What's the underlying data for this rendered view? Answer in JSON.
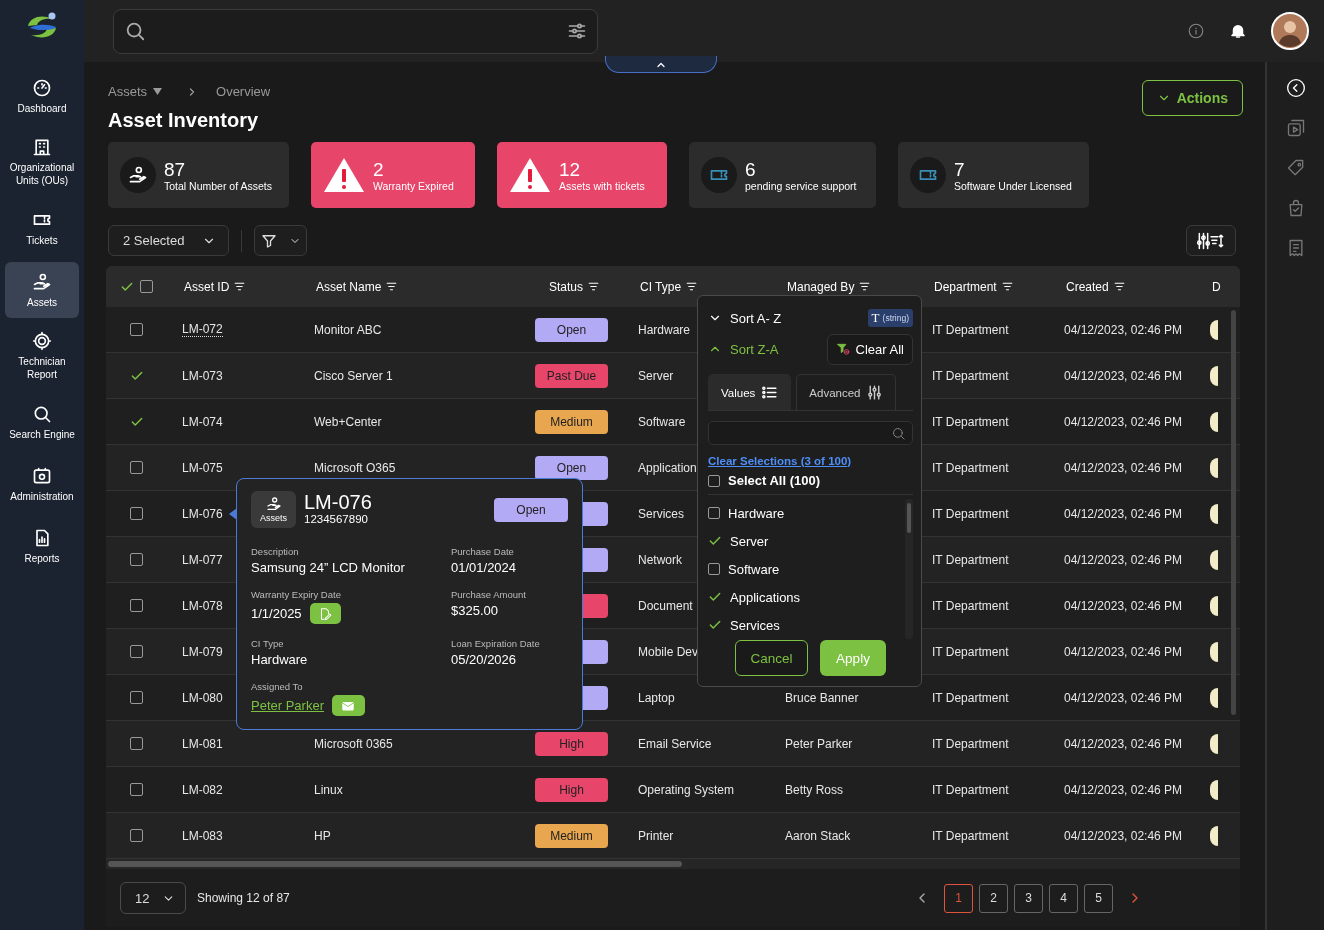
{
  "sidebar": {
    "items": [
      {
        "label": "Dashboard",
        "selected": false
      },
      {
        "label": "Organizational Units (OUs)",
        "selected": false
      },
      {
        "label": "Tickets",
        "selected": false
      },
      {
        "label": "Assets",
        "selected": true
      },
      {
        "label": "Technician Report",
        "selected": false
      },
      {
        "label": "Search Engine",
        "selected": false
      },
      {
        "label": "Administration",
        "selected": false
      },
      {
        "label": "Reports",
        "selected": false
      }
    ]
  },
  "breadcrumb": [
    "Assets",
    "Overview"
  ],
  "page_title": "Asset Inventory",
  "actions_button": "Actions",
  "stat_cards": [
    {
      "value": "87",
      "label": "Total Number of Assets",
      "kind": "total"
    },
    {
      "value": "2",
      "label": "Warranty Expired",
      "kind": "alert"
    },
    {
      "value": "12",
      "label": "Assets with tickets",
      "kind": "alert"
    },
    {
      "value": "6",
      "label": "pending service support",
      "kind": "ticket"
    },
    {
      "value": "7",
      "label": "Software Under Licensed",
      "kind": "ticket"
    }
  ],
  "toolbar": {
    "selection": "2 Selected"
  },
  "table": {
    "header_checked": false,
    "columns": [
      "Asset ID",
      "Asset Name",
      "Status",
      "CI Type",
      "Managed By",
      "Department",
      "Created",
      "D"
    ],
    "rows": [
      {
        "checked": false,
        "linked": true,
        "expanded": false,
        "asset_id": "LM-072",
        "asset_name": "Monitor ABC",
        "status": "Open",
        "color": "#b3aaf5",
        "ci_type": "Hardware",
        "department": "IT Department",
        "created": "04/12/2023, 02:46 PM"
      },
      {
        "checked": true,
        "linked": false,
        "expanded": false,
        "asset_id": "LM-073",
        "asset_name": "Cisco Server 1",
        "status": "Past Due",
        "color": "#e8456b",
        "ci_type": "Server",
        "department": "IT Department",
        "created": "04/12/2023, 02:46 PM"
      },
      {
        "checked": true,
        "linked": false,
        "expanded": false,
        "asset_id": "LM-074",
        "asset_name": "Web+Center",
        "status": "Medium",
        "color": "#e8a64f",
        "ci_type": "Software",
        "department": "IT Department",
        "created": "04/12/2023, 02:46 PM"
      },
      {
        "checked": false,
        "linked": false,
        "expanded": false,
        "asset_id": "LM-075",
        "asset_name": "Microsoft O365",
        "status": "Open",
        "color": "#b3aaf5",
        "ci_type": "Application",
        "department": "IT Department",
        "created": "04/12/2023, 02:46 PM"
      },
      {
        "checked": false,
        "linked": false,
        "expanded": true,
        "asset_id": "LM-076",
        "color": "#b3aaf5",
        "ci_type": "Services",
        "department": "IT Department",
        "created": "04/12/2023, 02:46 PM"
      },
      {
        "checked": false,
        "linked": false,
        "expanded": false,
        "asset_id": "LM-077",
        "color": "#b3aaf5",
        "ci_type": "Network",
        "department": "IT Department",
        "created": "04/12/2023, 02:46 PM"
      },
      {
        "checked": false,
        "linked": false,
        "expanded": false,
        "asset_id": "LM-078",
        "color": "#e8456b",
        "ci_type": "Document",
        "department": "IT Department",
        "created": "04/12/2023, 02:46 PM"
      },
      {
        "checked": false,
        "linked": false,
        "expanded": false,
        "asset_id": "LM-079",
        "color": "#b3aaf5",
        "ci_type": "Mobile Dev",
        "department": "IT Department",
        "created": "04/12/2023, 02:46 PM"
      },
      {
        "checked": false,
        "linked": false,
        "expanded": false,
        "asset_id": "LM-080",
        "color": "#b3aaf5",
        "ci_type": "Laptop",
        "managed_by": "Bruce Banner",
        "department": "IT Department",
        "created": "04/12/2023, 02:46 PM"
      },
      {
        "checked": false,
        "linked": false,
        "expanded": false,
        "asset_id": "LM-081",
        "asset_name": "Microsoft 0365",
        "status": "High",
        "color": "#e8456b",
        "ci_type": "Email Service",
        "managed_by": "Peter Parker",
        "department": "IT Department",
        "created": "04/12/2023, 02:46 PM"
      },
      {
        "checked": false,
        "linked": false,
        "expanded": false,
        "asset_id": "LM-082",
        "asset_name": "Linux",
        "status": "High",
        "color": "#e8456b",
        "ci_type": "Operating System",
        "managed_by": "Betty Ross",
        "department": "IT Department",
        "created": "04/12/2023, 02:46 PM"
      },
      {
        "checked": false,
        "linked": false,
        "expanded": false,
        "asset_id": "LM-083",
        "asset_name": "HP",
        "status": "Medium",
        "color": "#e8a64f",
        "ci_type": "Printer",
        "managed_by": "Aaron Stack",
        "department": "IT Department",
        "created": "04/12/2023, 02:46 PM"
      }
    ]
  },
  "asset_popup": {
    "category": "Assets",
    "asset_id": "LM-076",
    "serial": "1234567890",
    "status": "Open",
    "color": "#b3aaf5",
    "fields": [
      {
        "label": "Description",
        "value": "Samsung 24” LCD Monitor",
        "kind": "text"
      },
      {
        "label": "Purchase Date",
        "value": "01/01/2024",
        "kind": "text"
      },
      {
        "label": "Warranty Expiry Date",
        "value": "1/1/2025",
        "kind": "edit"
      },
      {
        "label": "Purchase Amount",
        "value": "$325.00",
        "kind": "text"
      },
      {
        "label": "CI Type",
        "value": "Hardware",
        "kind": "text"
      },
      {
        "label": "Loan Expiration Date",
        "value": "05/20/2026",
        "kind": "text"
      },
      {
        "label": "Assigned To",
        "value": "Peter Parker",
        "kind": "link"
      }
    ]
  },
  "filter_menu": {
    "sort": [
      {
        "label": "Sort A- Z",
        "selected": false
      },
      {
        "label": "Sort Z-A",
        "selected": true
      }
    ],
    "type_badge": {
      "icon": "T",
      "label": "(string)"
    },
    "clear_all": "Clear All",
    "tabs": [
      {
        "label": "Values",
        "selected": true
      },
      {
        "label": "Advanced",
        "selected": false
      }
    ],
    "clear_selections": "Clear Selections (3 of 100)",
    "select_all": {
      "label": "Select All (100)",
      "checked": false
    },
    "options": [
      {
        "label": "Hardware",
        "checked": false
      },
      {
        "label": "Server",
        "checked": true
      },
      {
        "label": "Software",
        "checked": false
      },
      {
        "label": "Applications",
        "checked": true
      },
      {
        "label": "Services",
        "checked": true
      }
    ],
    "cancel": "Cancel",
    "apply": "Apply"
  },
  "pagination": {
    "page_size": "12",
    "summary": "Showing 12 of 87",
    "pages": [
      {
        "label": "1",
        "selected": true
      },
      {
        "label": "2",
        "selected": false
      },
      {
        "label": "3",
        "selected": false
      },
      {
        "label": "4",
        "selected": false
      },
      {
        "label": "5",
        "selected": false
      }
    ]
  }
}
